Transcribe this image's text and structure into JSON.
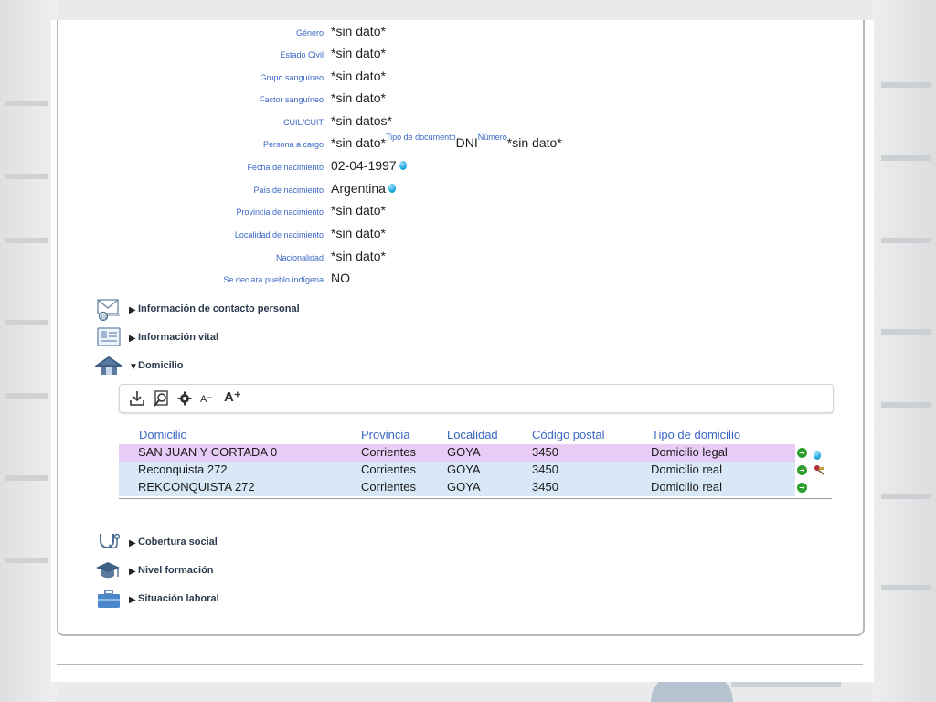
{
  "fields": [
    {
      "label": "Género",
      "value": "*sin dato*"
    },
    {
      "label": "Estado Civil",
      "value": "*sin dato*"
    },
    {
      "label": "Grupo sanguíneo",
      "value": "*sin dato*"
    },
    {
      "label": "Factor sanguíneo",
      "value": "*sin dato*"
    },
    {
      "label": "CUIL/CUIT",
      "value": "*sin datos*"
    },
    {
      "label": "Persona a cargo",
      "value": "*sin dato*",
      "tipo_doc_label": "Tipo de documento",
      "tipo_doc_value": "DNI",
      "numero_label": "Número",
      "numero_value": "*sin dato*"
    },
    {
      "label": "Fecha de nacimiento",
      "value": "02-04-1997"
    },
    {
      "label": "País de nacimiento",
      "value": "Argentina"
    },
    {
      "label": "Provincia de nacimiento",
      "value": "*sin dato*"
    },
    {
      "label": "Localidad de nacimiento",
      "value": "*sin dato*"
    },
    {
      "label": "Nacionalidad",
      "value": "*sin dato*"
    },
    {
      "label": "Se declara pueblo indígena",
      "value": "NO"
    }
  ],
  "sections": {
    "contacto": {
      "toggle": "▶",
      "title": "Información de contacto personal"
    },
    "vital": {
      "toggle": "▶",
      "title": "Información vital"
    },
    "domicilio": {
      "toggle": "▼",
      "title": "Domicilio"
    },
    "cobertura": {
      "toggle": "▶",
      "title": "Cobertura social"
    },
    "formacion": {
      "toggle": "▶",
      "title": "Nivel formación"
    },
    "laboral": {
      "toggle": "▶",
      "title": "Situación laboral"
    }
  },
  "toolbar": {
    "font_smaller": "A⁻",
    "font_larger": "A⁺",
    "icons": [
      "download-icon",
      "search-icon",
      "gear-icon"
    ]
  },
  "domicilio_table": {
    "columns": [
      "Domicilio",
      "Provincia",
      "Localidad",
      "Código postal",
      "Tipo de domicilio"
    ],
    "rows": [
      {
        "domicilio": "SAN JUAN Y CORTADA 0",
        "provincia": "Corrientes",
        "localidad": "GOYA",
        "cp": "3450",
        "tipo": "Domicilio legal"
      },
      {
        "domicilio": "Reconquista 272",
        "provincia": "Corrientes",
        "localidad": "GOYA",
        "cp": "3450",
        "tipo": "Domicilio real"
      },
      {
        "domicilio": "REKCONQUISTA 272",
        "provincia": "Corrientes",
        "localidad": "GOYA",
        "cp": "3450",
        "tipo": "Domicilio real"
      }
    ]
  },
  "colors": {
    "label_blue": "#3a67c4",
    "row_legal": "#e8ccf5",
    "row_real": "#d9e8f7",
    "go_green": "#2a9d2a",
    "info_cyan": "#16a3da"
  }
}
